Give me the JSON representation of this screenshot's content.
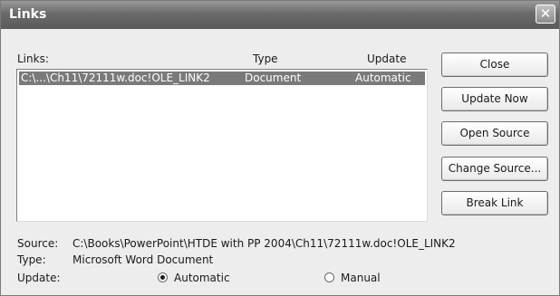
{
  "dialog": {
    "title": "Links",
    "close_glyph": "✕"
  },
  "list": {
    "headers": {
      "links": "Links:",
      "type": "Type",
      "update": "Update"
    },
    "rows": [
      {
        "link": "C:\\...\\Ch11\\72111w.doc!OLE_LINK2",
        "type": "Document",
        "update": "Automatic",
        "selected": true
      }
    ]
  },
  "buttons": {
    "close": "Close",
    "update_now": "Update Now",
    "open_source": "Open Source",
    "change_source": "Change Source...",
    "break_link": "Break Link"
  },
  "details": {
    "source_label": "Source:",
    "source_value": "C:\\Books\\PowerPoint\\HTDE with PP 2004\\Ch11\\72111w.doc!OLE_LINK2",
    "type_label": "Type:",
    "type_value": "Microsoft Word Document",
    "update_label": "Update:",
    "automatic_label": "Automatic",
    "manual_label": "Manual",
    "update_mode": "Automatic"
  },
  "colors": {
    "selection": "#7a7a7a",
    "titlebar": "#6a6a6a",
    "dialog_bg": "#ededed"
  }
}
